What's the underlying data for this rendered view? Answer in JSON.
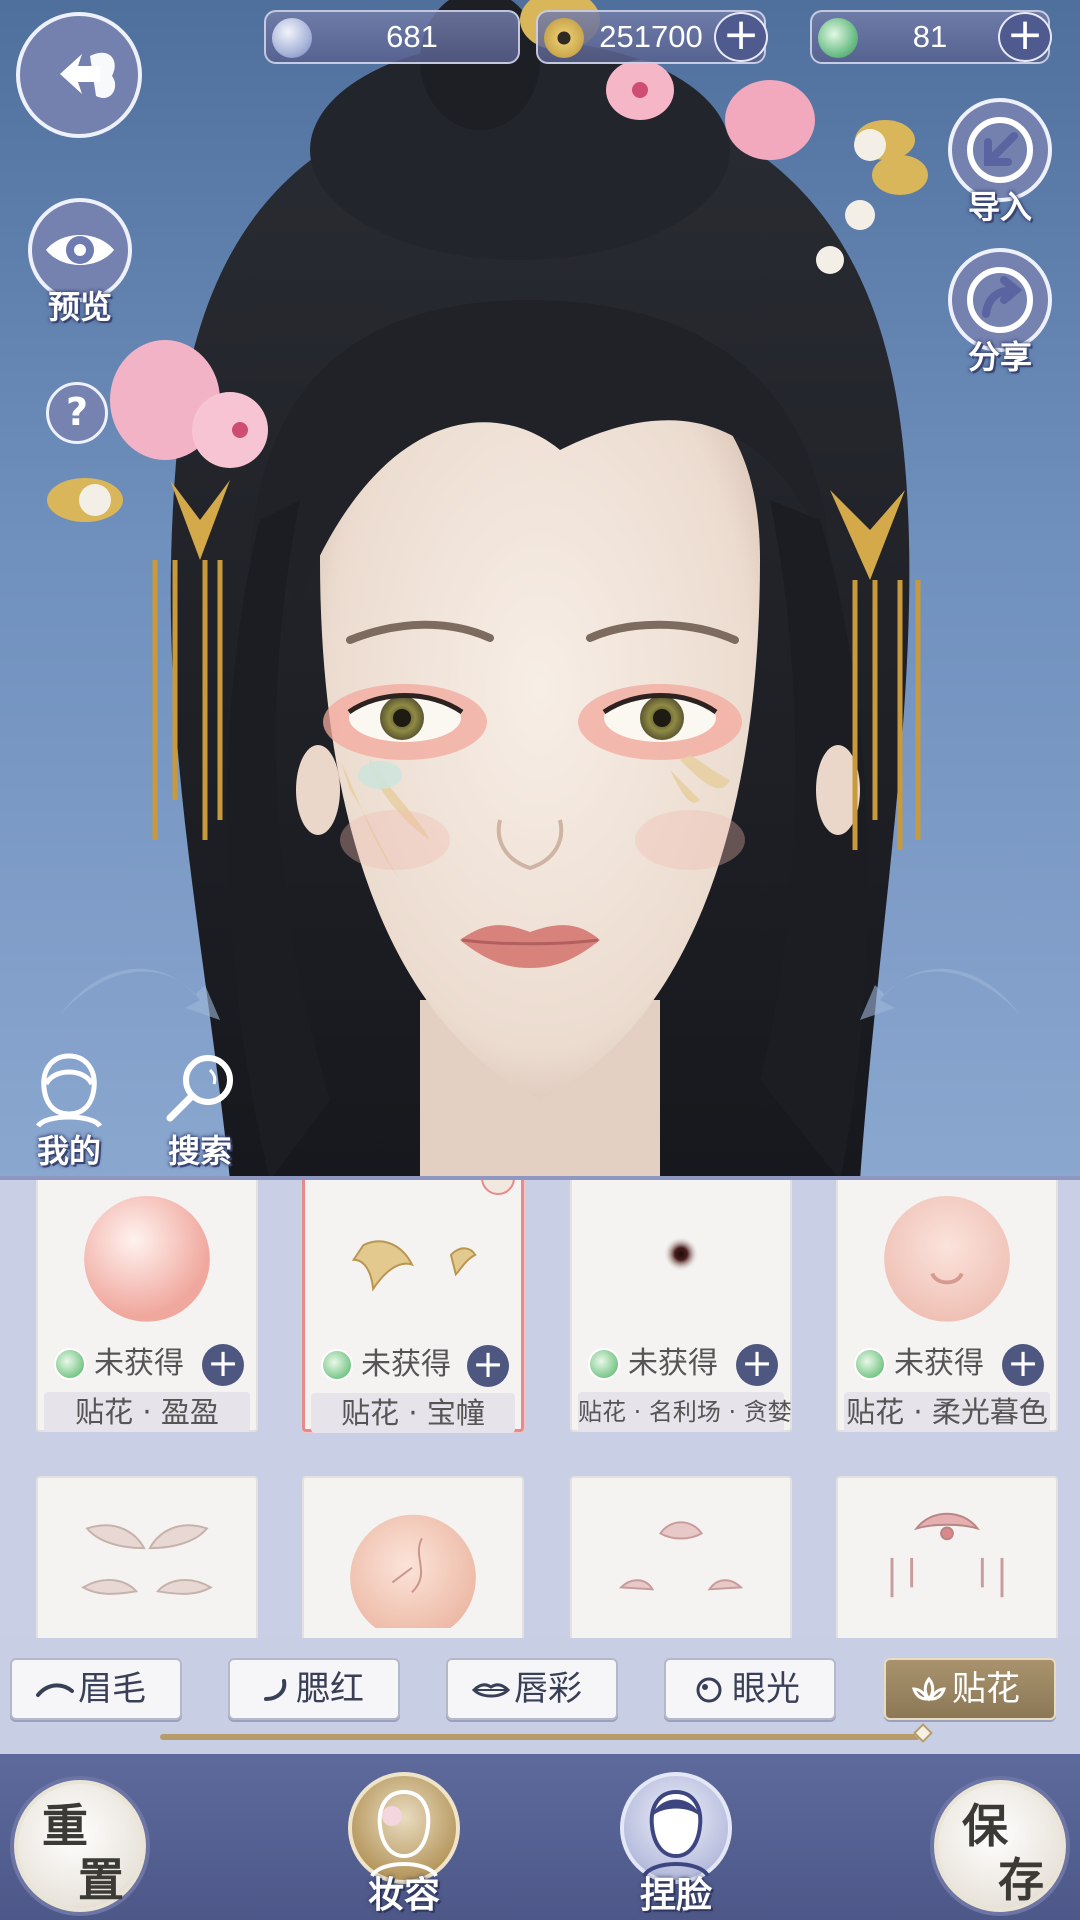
{
  "currency": [
    {
      "icon": "feather-coin-icon",
      "value": "681",
      "has_add": false
    },
    {
      "icon": "copper-coin-icon",
      "value": "251700",
      "has_add": true
    },
    {
      "icon": "jade-token-icon",
      "value": "81",
      "has_add": true
    }
  ],
  "side": {
    "preview_label": "预览",
    "import_label": "导入",
    "share_label": "分享",
    "help_glyph": "?",
    "mine_label": "我的",
    "search_label": "搜索"
  },
  "items": [
    {
      "status": "未获得",
      "name": "贴花 · 盈盈",
      "thumb": "pink-sphere",
      "selected": false
    },
    {
      "status": "未获得",
      "name": "贴花 · 宝幢",
      "thumb": "gold-decal",
      "selected": true
    },
    {
      "status": "未获得",
      "name": "贴花 · 名利场 · 贪婪",
      "thumb": "dot",
      "selected": false
    },
    {
      "status": "未获得",
      "name": "贴花 · 柔光暮色",
      "thumb": "nose",
      "selected": false
    },
    {
      "status": "",
      "name": "",
      "thumb": "feathers",
      "selected": false
    },
    {
      "status": "",
      "name": "",
      "thumb": "crack-sphere",
      "selected": false
    },
    {
      "status": "",
      "name": "",
      "thumb": "lotus",
      "selected": false
    },
    {
      "status": "",
      "name": "",
      "thumb": "crown",
      "selected": false
    }
  ],
  "tabs": [
    {
      "label": "眉毛",
      "icon": "eyebrow-icon",
      "active": false
    },
    {
      "label": "腮红",
      "icon": "blush-icon",
      "active": false
    },
    {
      "label": "唇彩",
      "icon": "lips-icon",
      "active": false
    },
    {
      "label": "眼光",
      "icon": "eye-light-icon",
      "active": false
    },
    {
      "label": "贴花",
      "icon": "lotus-icon",
      "active": true
    }
  ],
  "bottom": {
    "reset_top": "重",
    "reset_bottom": "置",
    "makeup_label": "妆容",
    "face_label": "捏脸",
    "save_top": "保",
    "save_bottom": "存"
  },
  "colors": {
    "accent_gold": "#a8936e",
    "selected_border": "#e98a8a",
    "nav_dark": "#4d5889"
  }
}
